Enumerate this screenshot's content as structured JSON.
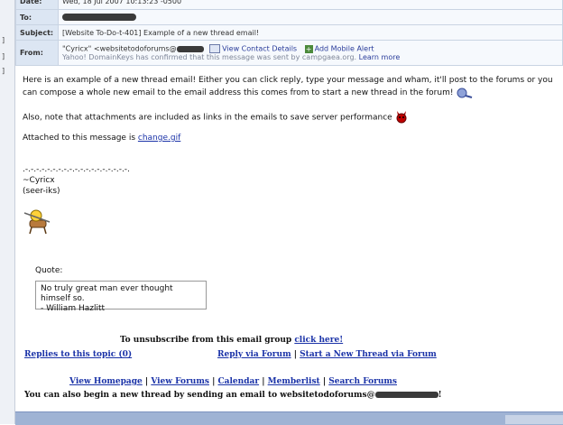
{
  "header": {
    "date_label": "Date:",
    "date_value": "Wed, 18 Jul 2007 10:13:23 -0500",
    "to_label": "To:",
    "subject_label": "Subject:",
    "subject_value": "[Website To-Do-t-401] Example of a new thread email!",
    "from_label": "From:",
    "from_value": "\"Cyricx\" <websitetodoforums@",
    "view_contact": "View Contact Details",
    "add_mobile": "Add Mobile Alert",
    "domainkeys": "Yahoo! DomainKeys has confirmed that this message was sent by campgaea.org.",
    "learn_more": "Learn more"
  },
  "body": {
    "para1": "Here is an example of a new thread email! Either you can click reply, type your message and wham, it'll post to the forums or you can compose a whole new email to the email address this comes from to start a new thread in the forum!",
    "para2": "Also, note that attachments are included as links in the emails to save server performance",
    "para3_prefix": "Attached to this message is",
    "attachment_link": "change.gif",
    "divider": ".-.-.-.-.-.-.-.-.-.-.-.-.-.-.-.-.-.-.-.",
    "sig_name": "~Cyricx",
    "sig_pron": "(seer-iks)"
  },
  "quote": {
    "label": "Quote:",
    "text": "No truly great man ever thought himself so.",
    "author": "- William Hazlitt"
  },
  "footer": {
    "unsubscribe_prefix": "To unsubscribe from this email group",
    "unsubscribe_link": "click here!",
    "replies_link": "Replies to this topic (0)",
    "reply_forum_link": "Reply via Forum",
    "separator": "|",
    "new_thread_link": "Start a New Thread via Forum",
    "view_homepage": "View Homepage",
    "view_forums": "View Forums",
    "calendar": "Calendar",
    "memberlist": "Memberlist",
    "search_forums": "Search Forums",
    "email_note": "You can also begin a new thread by sending an email to websitetodoforums@",
    "email_end": "!"
  }
}
